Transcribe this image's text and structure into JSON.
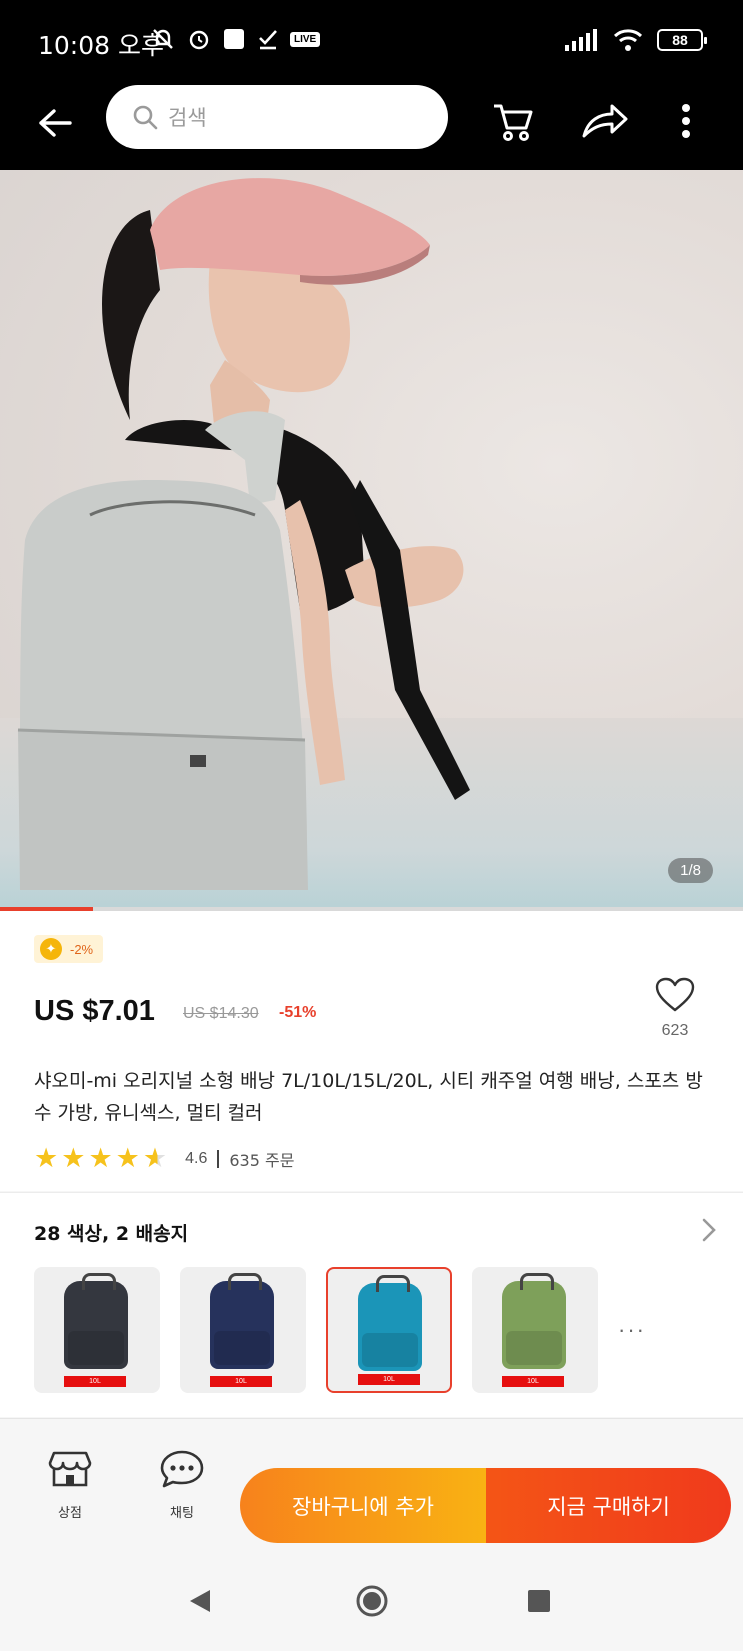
{
  "status_bar": {
    "time": "10:08 오후",
    "live_badge": "LIVE",
    "battery": "88"
  },
  "nav": {
    "search_placeholder": "검색"
  },
  "gallery": {
    "counter": "1/8",
    "progress": 0.125
  },
  "product": {
    "coin_discount": "-2%",
    "price": "US $7.01",
    "original_price": "US $14.30",
    "discount": "-51%",
    "wishlist_count": "623",
    "title": "샤오미-mi 오리지널 소형 배낭 7L/10L/15L/20L, 시티 캐주얼 여행 배낭, 스포츠 방수 가방, 유니섹스, 멀티 컬러",
    "rating": "4.6",
    "rating_stars": 4.6,
    "orders": "635 주문"
  },
  "variants": {
    "title": "28 색상, 2 배송지",
    "items": [
      {
        "color": "#34373f",
        "size_tag": "10L",
        "selected": false
      },
      {
        "color": "#26325c",
        "size_tag": "10L",
        "selected": false
      },
      {
        "color": "#1b95b8",
        "size_tag": "10L",
        "selected": true
      },
      {
        "color": "#7ea05a",
        "size_tag": "10L",
        "selected": false
      }
    ],
    "more": "···"
  },
  "actions": {
    "store_label": "상점",
    "chat_label": "채팅",
    "add_to_cart": "장바구니에 추가",
    "buy_now": "지금 구매하기"
  },
  "colors": {
    "accent": "#e8402c",
    "cart_orange": "#f7821c",
    "buy_red": "#f03a1c",
    "star": "#f6c21c"
  }
}
